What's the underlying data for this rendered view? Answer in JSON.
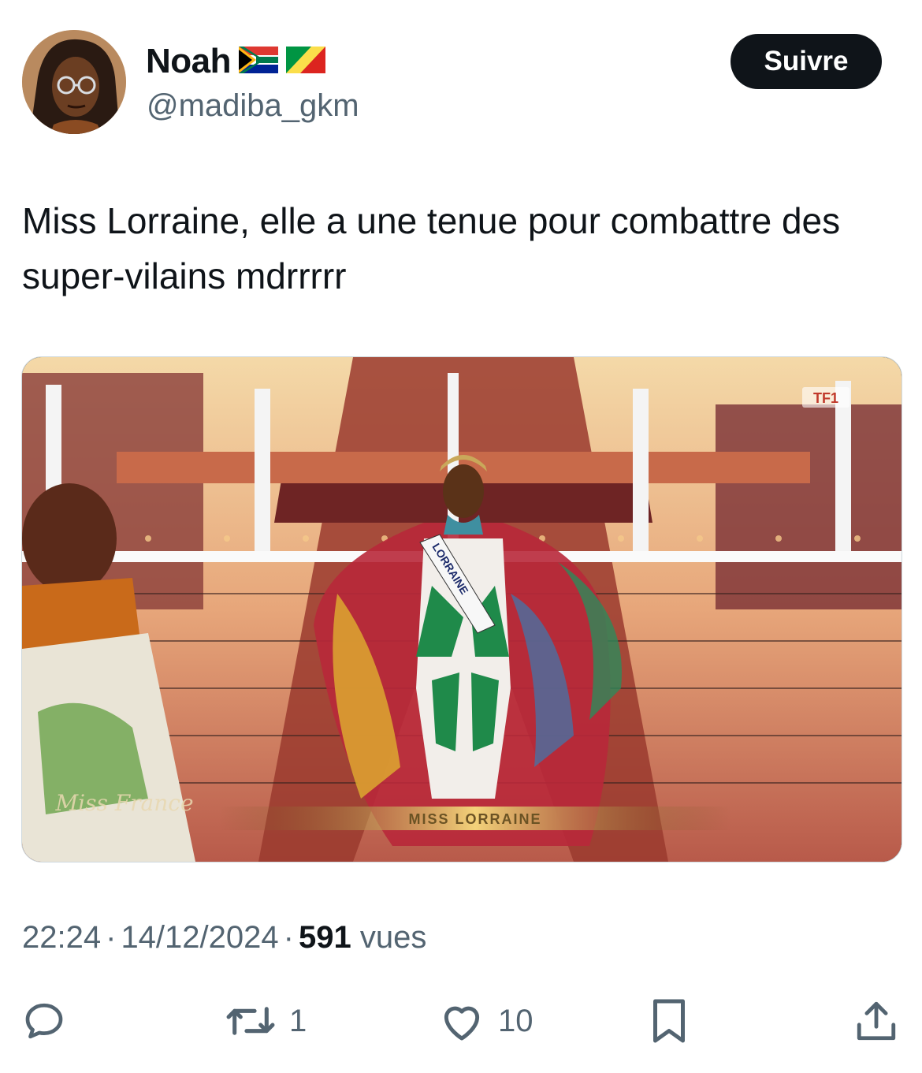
{
  "author": {
    "display_name": "Noah",
    "handle": "@madiba_gkm",
    "flags": [
      "south-africa-flag",
      "congo-flag"
    ]
  },
  "follow_button": {
    "label": "Suivre"
  },
  "tweet": {
    "text": "Miss Lorraine, elle a une tenue pour combattre des super-vilains mdrrrrr"
  },
  "media": {
    "sash_text": "LORRAINE",
    "lower_third": "MISS LORRAINE",
    "watermark": "Miss France",
    "channel_logo": "TF1"
  },
  "meta": {
    "time": "22:24",
    "date": "14/12/2024",
    "views_count": "591",
    "views_label": "vues",
    "separator": "·"
  },
  "actions": {
    "reply_icon": "reply-icon",
    "retweet_icon": "retweet-icon",
    "retweet_count": "1",
    "like_icon": "heart-icon",
    "like_count": "10",
    "bookmark_icon": "bookmark-icon",
    "share_icon": "share-icon"
  },
  "colors": {
    "text_primary": "#0f1419",
    "text_secondary": "#536471",
    "button_bg": "#0f1419"
  }
}
